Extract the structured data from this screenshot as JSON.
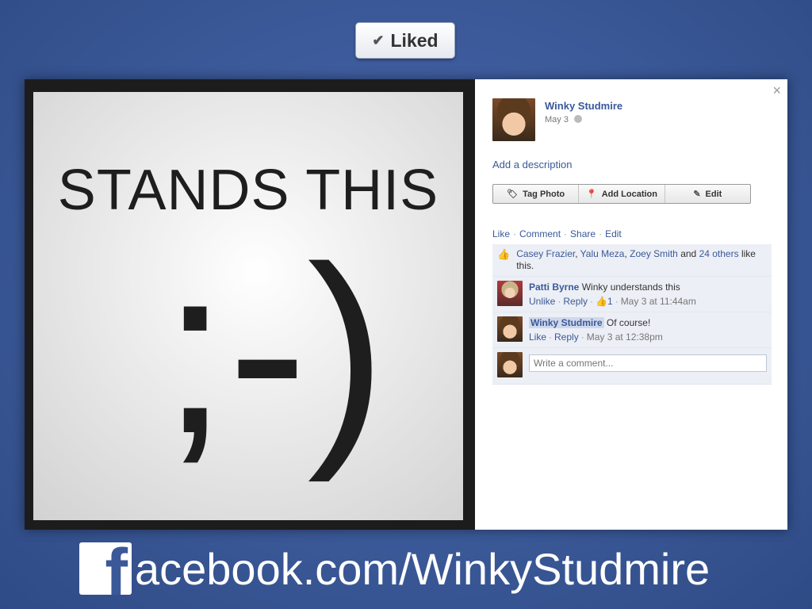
{
  "liked_button": {
    "icon": "checkmark-icon",
    "label": "Liked"
  },
  "photo": {
    "caption": "STANDS THIS",
    "emoticon": ";-)"
  },
  "post": {
    "author": "Winky Studmire",
    "date": "May 3",
    "privacy_icon": "globe-icon",
    "add_description": "Add a description",
    "close_symbol": "×"
  },
  "action_bar": {
    "tag_photo": "Tag Photo",
    "add_location": "Add Location",
    "edit": "Edit"
  },
  "actions": {
    "like": "Like",
    "comment": "Comment",
    "share": "Share",
    "edit": "Edit",
    "separator": "·"
  },
  "likes": {
    "names": [
      "Casey Frazier",
      "Yalu Meza",
      "Zoey Smith"
    ],
    "others": "24 others",
    "and": "and",
    "suffix": "like this."
  },
  "comments": [
    {
      "author": "Patti Byrne",
      "text": "Winky understands this",
      "primary_action": "Unlike",
      "reply": "Reply",
      "like_count": "1",
      "timestamp": "May 3 at 11:44am"
    },
    {
      "author": "Winky Studmire",
      "text": "Of course!",
      "primary_action": "Like",
      "reply": "Reply",
      "timestamp": "May 3 at 12:38pm"
    }
  ],
  "comment_input": {
    "placeholder": "Write a comment..."
  },
  "footer": {
    "logo_letter": "f",
    "url": "acebook.com/WinkyStudmire"
  },
  "colors": {
    "brand": "#3b5998",
    "background": "#3b5998",
    "link": "#3b5998"
  }
}
